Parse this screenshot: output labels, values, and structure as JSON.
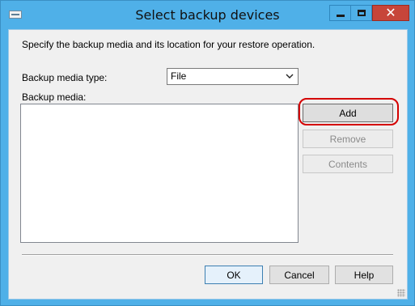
{
  "window": {
    "title": "Select backup devices",
    "icon": "dialog-icon",
    "controls": [
      "minimize-icon",
      "maximize-icon",
      "close-icon"
    ],
    "close_glyph": "✕",
    "colors": {
      "frame": "#4fb0e8",
      "close": "#c7453a",
      "highlight": "#d40000"
    }
  },
  "dialog": {
    "instruction": "Specify the backup media and its location for your restore operation.",
    "media_type_label": "Backup media type:",
    "media_type_value": "File",
    "media_label": "Backup media:",
    "media_items": []
  },
  "buttons": {
    "add": "Add",
    "remove": "Remove",
    "contents": "Contents",
    "ok": "OK",
    "cancel": "Cancel",
    "help": "Help"
  }
}
